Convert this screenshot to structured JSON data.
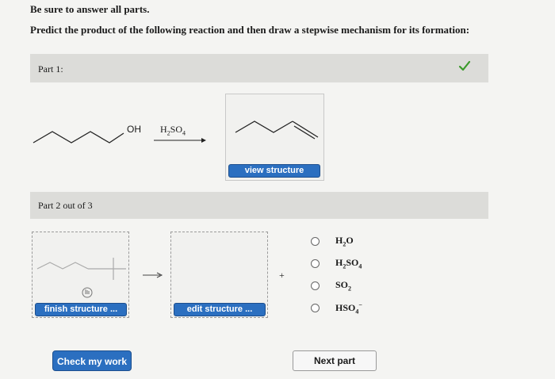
{
  "instructions": {
    "line1": "Be sure to answer all parts.",
    "line2": "Predict the product of the following reaction and then draw a stepwise mechanism for its formation:"
  },
  "part1": {
    "label": "Part 1:",
    "reactant_group": "OH",
    "reagent_main": "H",
    "reagent_sub1": "2",
    "reagent_rest": "SO",
    "reagent_sub2": "4",
    "view_button": "view structure"
  },
  "part2": {
    "label": "Part 2 out of 3",
    "finish_button": "finish structure ...",
    "edit_button": "edit structure ...",
    "plus": "+",
    "options": [
      {
        "main": "H",
        "sub": "2",
        "rest": "O",
        "sub2": "",
        "sup": ""
      },
      {
        "main": "H",
        "sub": "2",
        "rest": "SO",
        "sub2": "4",
        "sup": ""
      },
      {
        "main": "SO",
        "sub": "2",
        "rest": "",
        "sub2": "",
        "sup": ""
      },
      {
        "main": "HSO",
        "sub": "4",
        "rest": "",
        "sub2": "",
        "sup": "−"
      }
    ]
  },
  "footer": {
    "check_button": "Check my work",
    "next_button": "Next part"
  },
  "colors": {
    "accent": "#2b6fc0",
    "check": "#3a9a2a"
  }
}
